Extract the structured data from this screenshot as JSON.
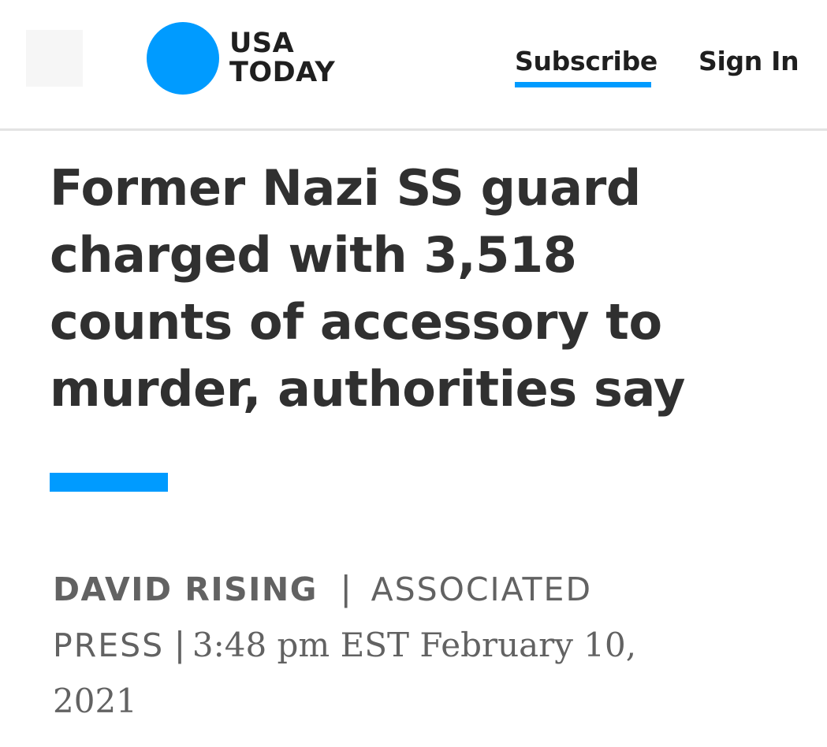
{
  "header": {
    "logo": {
      "line1": "USA",
      "line2": "TODAY",
      "dot_color": "#009bff"
    },
    "menu_placeholder": "menu-icon",
    "subscribe_label": "Subscribe",
    "signin_label": "Sign In",
    "accent_color": "#009bff"
  },
  "article": {
    "headline_lines": [
      "Former Nazi SS guard",
      "charged with 3,518",
      "counts of accessory to",
      "murder, authorities say"
    ],
    "byline": {
      "author": "DAVID RISING",
      "separator": "|",
      "source_line1": "ASSOCIATED",
      "source_line2": "PRESS",
      "timestamp_line1": "3:48 pm EST February 10,",
      "timestamp_line2": "2021"
    }
  }
}
